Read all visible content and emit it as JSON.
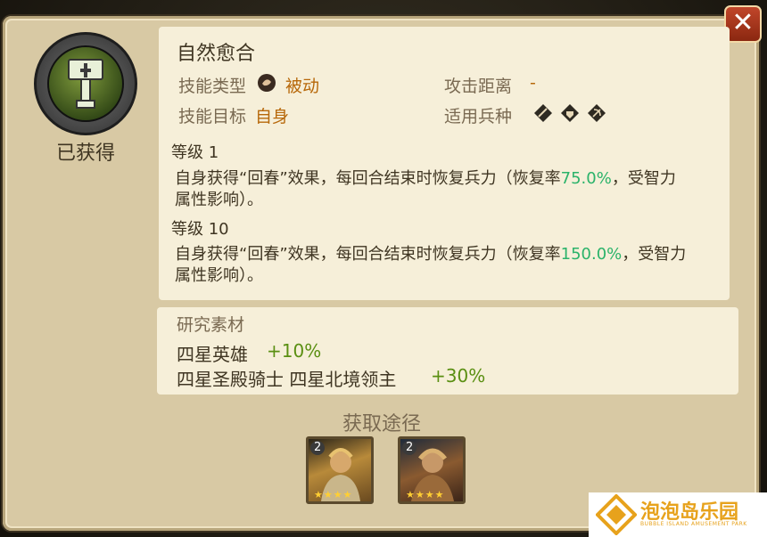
{
  "skill": {
    "name": "自然愈合",
    "acquired_label": "已获得",
    "type_label": "技能类型",
    "type_value": "被动",
    "range_label": "攻击距离",
    "range_value": "-",
    "target_label": "技能目标",
    "target_value": "自身",
    "troops_label": "适用兵种",
    "troop_icons": [
      "sword-troop-icon",
      "shield-troop-icon",
      "bow-troop-icon"
    ]
  },
  "levels": [
    {
      "label": "等级 1",
      "desc_pre": "自身获得“回春”效果，每回合结束时恢复兵力（恢复率",
      "rate": "75.0%",
      "desc_post": "，受智力",
      "desc_line2": "属性影响）。"
    },
    {
      "label": "等级 10",
      "desc_pre": "自身获得“回春”效果，每回合结束时恢复兵力（恢复率",
      "rate": "150.0%",
      "desc_post": "，受智力",
      "desc_line2": "属性影响）。"
    }
  ],
  "research": {
    "title": "研究素材",
    "rows": [
      {
        "name": "四星英雄",
        "bonus": "+10%"
      },
      {
        "name": "四星圣殿骑士 四星北境领主",
        "bonus": "+30%"
      }
    ]
  },
  "source": {
    "title": "获取途径",
    "cards": [
      {
        "badge": "2",
        "stars": "★★★★"
      },
      {
        "badge": "2",
        "stars": "★★★★"
      }
    ]
  },
  "watermark": {
    "name": "泡泡岛乐园",
    "sub": "BUBBLE ISLAND AMUSEMENT PARK"
  },
  "colors": {
    "accent_orange": "#b7680a",
    "rate_green": "#2bb36a",
    "bonus_green": "#5a8f12",
    "close_red": "#c1462a"
  }
}
